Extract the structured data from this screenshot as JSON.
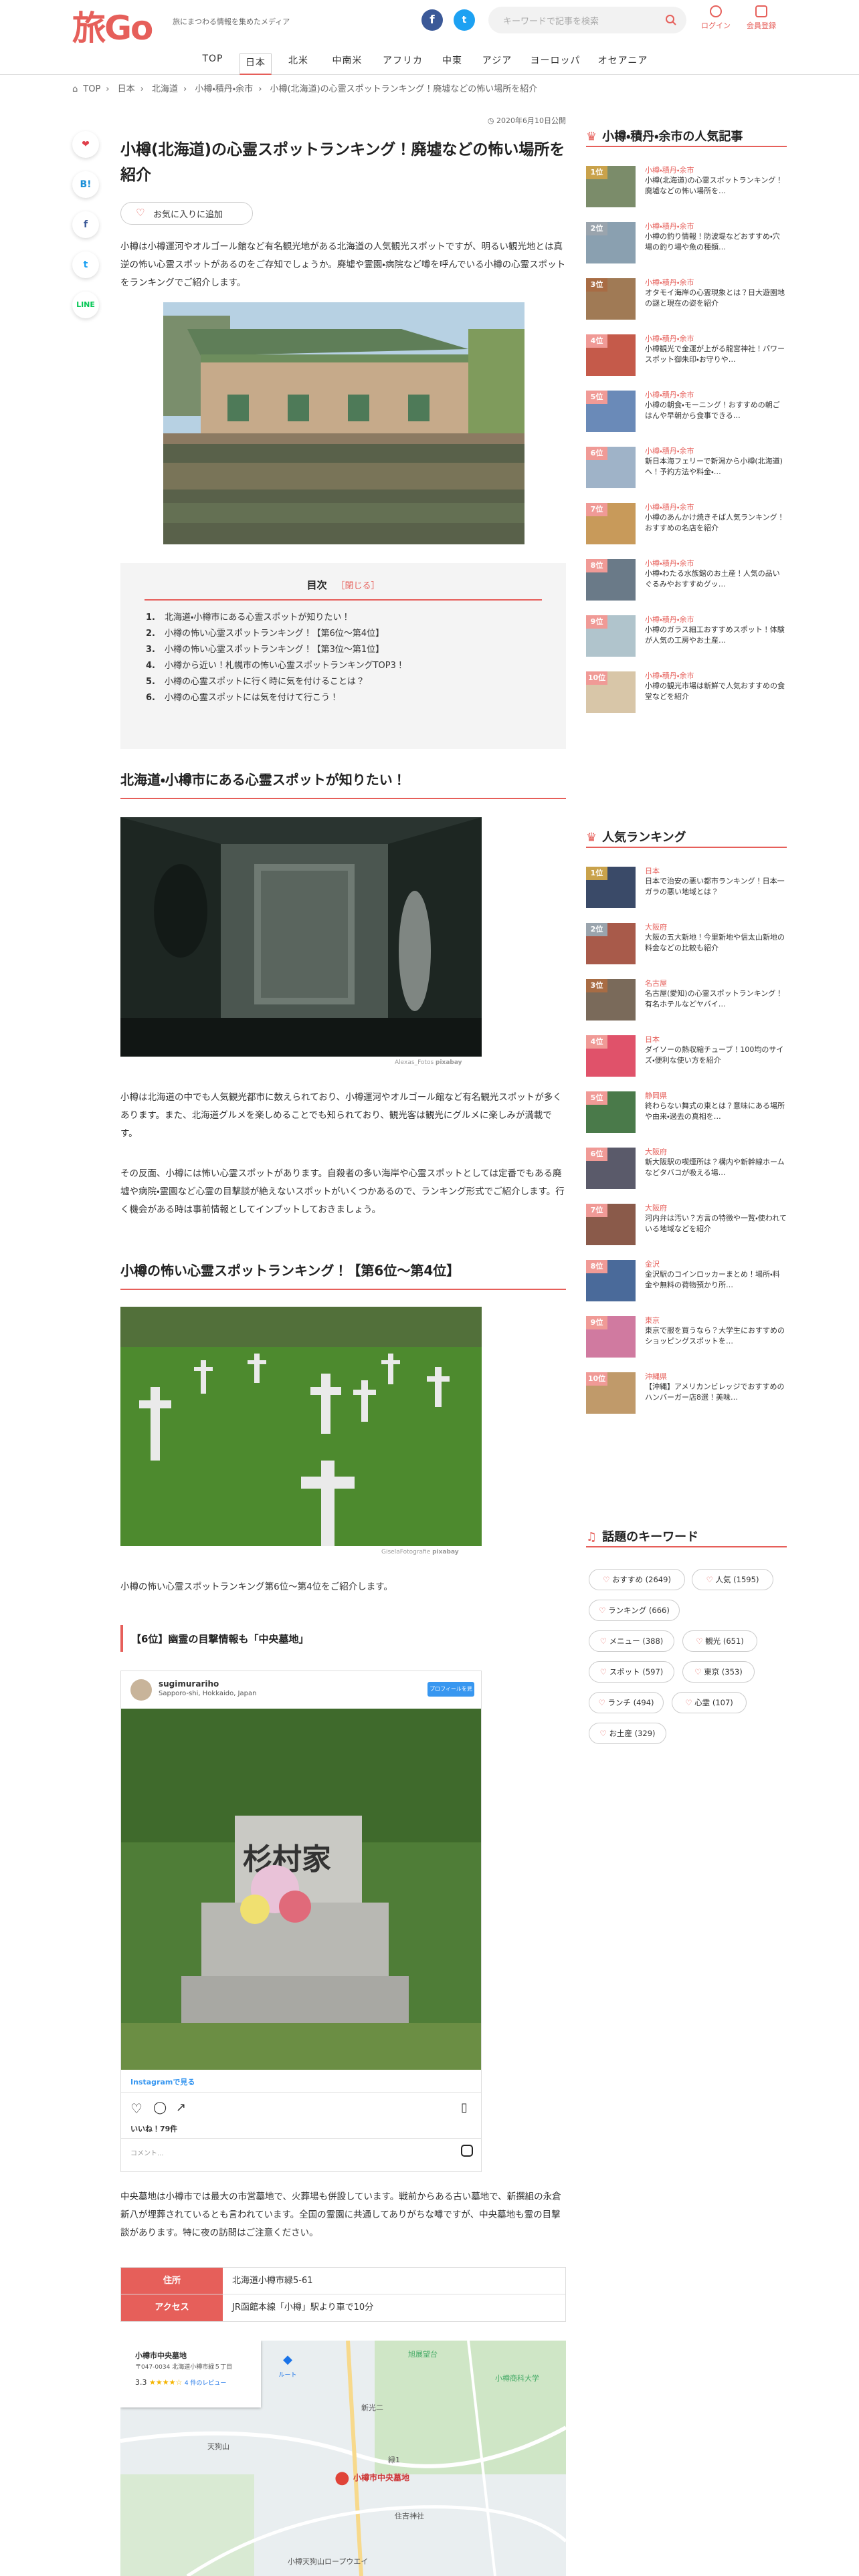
{
  "header": {
    "logo": "旅Go",
    "tagline": "旅にまつわる情報を集めたメディア",
    "search_placeholder": "キーワードで記事を検索",
    "login": "ログイン",
    "register": "会員登録"
  },
  "nav": [
    "TOP",
    "日本",
    "北米",
    "中南米",
    "アフリカ",
    "中東",
    "アジア",
    "ヨーロッパ",
    "オセアニア"
  ],
  "breadcrumb": [
    "TOP",
    "日本",
    "北海道",
    "小樽・積丹・余市",
    "小樽(北海道)の心霊スポットランキング！廃墟などの怖い場所を紹介"
  ],
  "article": {
    "date": "2020年6月10日公開",
    "title": "小樽(北海道)の心霊スポットランキング！廃墟などの怖い場所を紹介",
    "favorite": "お気に入りに追加",
    "intro": "小樽は小樽運河やオルゴール館など有名観光地がある北海道の人気観光スポットですが、明るい観光地とは真逆の怖い心霊スポットがあるのをご存知でしょうか。廃墟や霊園・病院など噂を呼んでいる小樽の心霊スポットをランキングでご紹介します。",
    "toc_title": "目次",
    "toc_toggle": "［閉じる］",
    "toc": [
      "北海道・小樽市にある心霊スポットが知りたい！",
      "小樽の怖い心霊スポットランキング！【第6位〜第4位】",
      "小樽の怖い心霊スポットランキング！【第3位〜第1位】",
      "小樽から近い！札幌市の怖い心霊スポットランキングTOP3！",
      "小樽の心霊スポットに行く時に気を付けることは？",
      "小樽の心霊スポットには気を付けて行こう！"
    ],
    "h2_1": "北海道・小樽市にある心霊スポットが知りたい！",
    "credit_1": "Alexas_Fotos",
    "credit_brand": "pixabay",
    "p1": "小樽は北海道の中でも人気観光都市に数えられており、小樽運河やオルゴール館など有名観光スポットが多くあります。また、北海道グルメを楽しめることでも知られており、観光客は観光にグルメに楽しみが満載です。",
    "p2": "その反面、小樽には怖い心霊スポットがあります。自殺者の多い海岸や心霊スポットとしては定番でもある廃墟や病院・霊園など心霊の目撃談が絶えないスポットがいくつかあるので、ランキング形式でご紹介します。行く機会がある時は事前情報としてインプットしておきましょう。",
    "h2_2": "小樽の怖い心霊スポットランキング！【第6位〜第4位】",
    "credit_2": "GiselaFotografie",
    "p3": "小樽の怖い心霊スポットランキング第6位〜第4位をご紹介します。",
    "h3_1": "【6位】幽霊の目撃情報も「中央墓地」",
    "p4": "中央墓地は小樽市では最大の市営墓地で、火葬場も併設しています。戦前からある古い墓地で、新撰組の永倉新八が埋葬されているとも言われています。全国の霊園に共通してありがちな噂ですが、中央墓地も霊の目撃談があります。特に夜の訪問はご注意ください。",
    "info": [
      {
        "k": "住所",
        "v": "北海道小樽市緑5-61"
      },
      {
        "k": "アクセス",
        "v": "JR函館本線「小樽」駅より車で10分"
      }
    ]
  },
  "instagram": {
    "user": "sugimurariho",
    "location": "Sapporo-shi, Hokkaido, Japan",
    "follow": "プロフィールを見る",
    "view_more": "Instagramで見る",
    "likes": "いいね！79件",
    "comment_placeholder": "コメント..."
  },
  "map": {
    "label": "小樽市中央墓地",
    "card_title": "小樽市中央墓地",
    "card_addr": "〒047-0034 北海道小樽市緑５丁目",
    "rating": "3.3",
    "reviews": "4 件のレビュー",
    "directions": "ルート",
    "places": [
      "旭展望台",
      "小樽商科大学",
      "新光二",
      "緑1",
      "天狗山",
      "住吉神社",
      "小樽天狗山ロープウエイ"
    ]
  },
  "sidebar": {
    "popular_title": "小樽・積丹・余市の人気記事",
    "popular": [
      {
        "rank": "1位",
        "cat": "小樽・積丹・余市",
        "title": "小樽(北海道)の心霊スポットランキング！廃墟などの怖い場所を…"
      },
      {
        "rank": "2位",
        "cat": "小樽・積丹・余市",
        "title": "小樽の釣り情報！防波堤などおすすめ・穴場の釣り場や魚の種類…"
      },
      {
        "rank": "3位",
        "cat": "小樽・積丹・余市",
        "title": "オタモイ海岸の心霊現象とは？日大遊園地の謎と現在の姿を紹介"
      },
      {
        "rank": "4位",
        "cat": "小樽・積丹・余市",
        "title": "小樽観光で金運が上がる龍宮神社！パワースポット御朱印・お守りや…"
      },
      {
        "rank": "5位",
        "cat": "小樽・積丹・余市",
        "title": "小樽の朝食・モーニング！おすすめの朝ごはんや早朝から食事できる…"
      },
      {
        "rank": "6位",
        "cat": "小樽・積丹・余市",
        "title": "新日本海フェリーで新潟から小樽(北海道)へ！予約方法や料金・…"
      },
      {
        "rank": "7位",
        "cat": "小樽・積丹・余市",
        "title": "小樽のあんかけ焼きそば人気ランキング！おすすめの名店を紹介"
      },
      {
        "rank": "8位",
        "cat": "小樽・積丹・余市",
        "title": "小樽・わたる水族館のお土産！人気の品いぐるみやおすすめグッ…"
      },
      {
        "rank": "9位",
        "cat": "小樽・積丹・余市",
        "title": "小樽のガラス細工おすすめスポット！体験が人気の工房やお土産…"
      },
      {
        "rank": "10位",
        "cat": "小樽・積丹・余市",
        "title": "小樽の観光市場は新鮮で人気おすすめの食堂などを紹介"
      }
    ],
    "ranking_title": "人気ランキング",
    "ranking": [
      {
        "rank": "1位",
        "cat": "日本",
        "title": "日本で治安の悪い都市ランキング！日本一ガラの悪い地域とは？"
      },
      {
        "rank": "2位",
        "cat": "大阪府",
        "title": "大阪の五大新地！今里新地や信太山新地の料金などの比較も紹介"
      },
      {
        "rank": "3位",
        "cat": "名古屋",
        "title": "名古屋(愛知)の心霊スポットランキング！有名ホテルなどヤバイ…"
      },
      {
        "rank": "4位",
        "cat": "日本",
        "title": "ダイソーの熱収縮チューブ！100均のサイズ・便利な使い方を紹介"
      },
      {
        "rank": "5位",
        "cat": "静岡県",
        "title": "終わらない舞式の東とは？意味にある場所や由来・過去の真相を…"
      },
      {
        "rank": "6位",
        "cat": "大阪府",
        "title": "新大阪駅の喫煙所は？構内や新幹線ホームなどタバコが吸える場…"
      },
      {
        "rank": "7位",
        "cat": "大阪府",
        "title": "河内弁は汚い？方言の特徴や一覧・使われている地域などを紹介"
      },
      {
        "rank": "8位",
        "cat": "金沢",
        "title": "金沢駅のコインロッカーまとめ！場所・料金や無料の荷物預かり所…"
      },
      {
        "rank": "9位",
        "cat": "東京",
        "title": "東京で服を買うなら？大学生におすすめのショッピングスポットを…"
      },
      {
        "rank": "10位",
        "cat": "沖縄県",
        "title": "【沖縄】アメリカンビレッジでおすすめのハンバーガー店8選！美味…"
      }
    ],
    "keywords_title": "話題のキーワード",
    "keywords": [
      "おすすめ (2649)",
      "人気 (1595)",
      "ランキング (666)",
      "メニュー (388)",
      "観光 (651)",
      "スポット (597)",
      "東京 (353)",
      "ランチ (494)",
      "心霊 (107)",
      "お土産 (329)"
    ]
  },
  "colors": {
    "accent": "#e65f5a",
    "rank_gold": "#c9a24b",
    "rank_silver": "#9aa4ad",
    "rank_bronze": "#a86c44",
    "rank_other": "#f09a96"
  }
}
